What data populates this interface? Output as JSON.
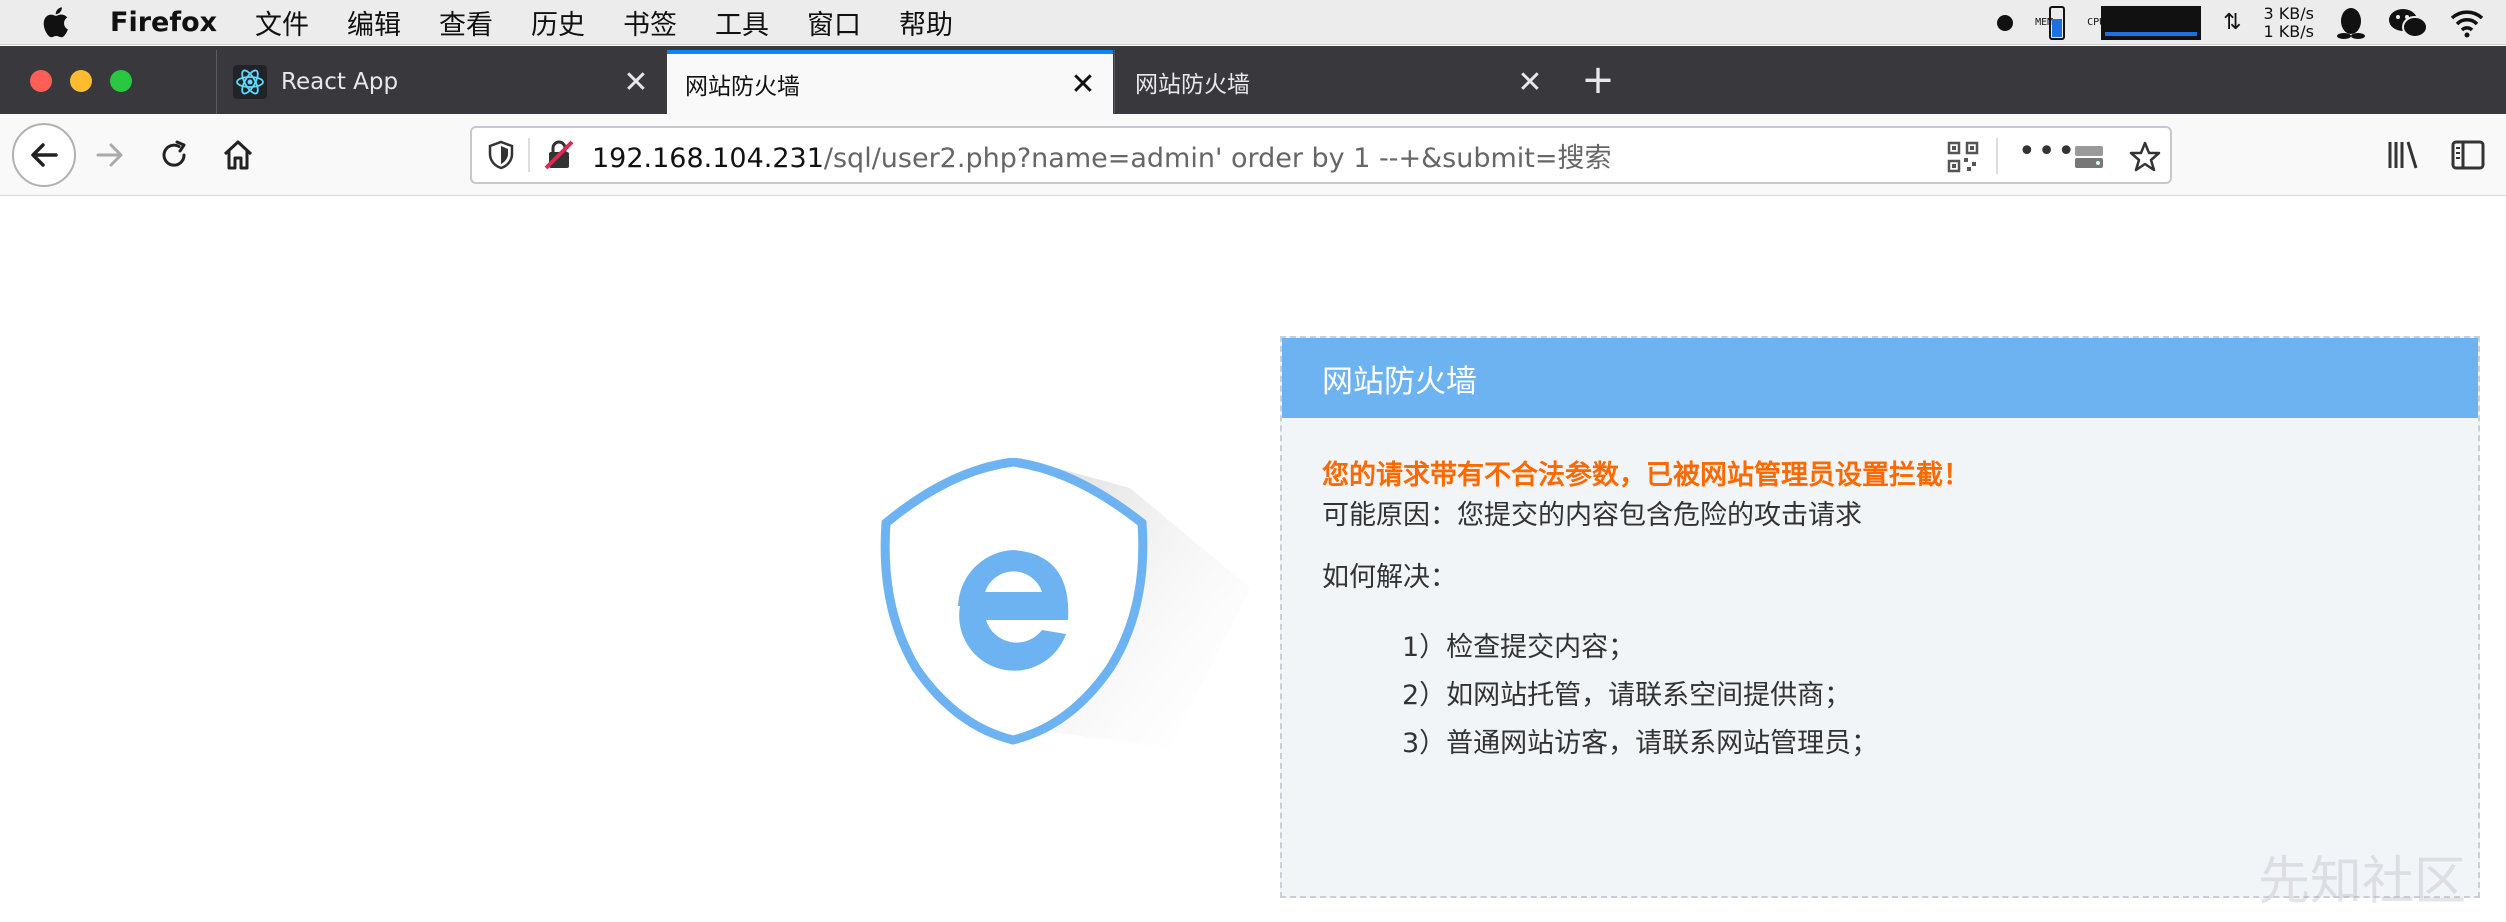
{
  "menubar": {
    "app_name": "Firefox",
    "items": [
      "文件",
      "编辑",
      "查看",
      "历史",
      "书签",
      "工具",
      "窗口",
      "帮助"
    ],
    "net_up": "3 KB/s",
    "net_down": "1 KB/s",
    "mem_label": "MEM",
    "cpu_label": "CPU"
  },
  "tabs": [
    {
      "title": "React App",
      "active": false
    },
    {
      "title": "网站防火墙",
      "active": true
    },
    {
      "title": "网站防火墙",
      "active": false
    }
  ],
  "urlbar": {
    "host": "192.168.104.231",
    "path": "/sql/user2.php?name=admin' order by 1 --+&submit=搜索"
  },
  "firewall": {
    "header": "网站防火墙",
    "alert": "您的请求带有不合法参数，已被网站管理员设置拦截！",
    "reason": "可能原因：您提交的内容包含危险的攻击请求",
    "howto": "如何解决：",
    "steps": [
      "1）检查提交内容；",
      "2）如网站托管，请联系空间提供商；",
      "3）普通网站访客，请联系网站管理员；"
    ]
  },
  "watermark": "先知社区",
  "colors": {
    "header_blue": "#6db3f2",
    "alert_orange": "#fa6a00",
    "tab_accent": "#0a84ff"
  }
}
